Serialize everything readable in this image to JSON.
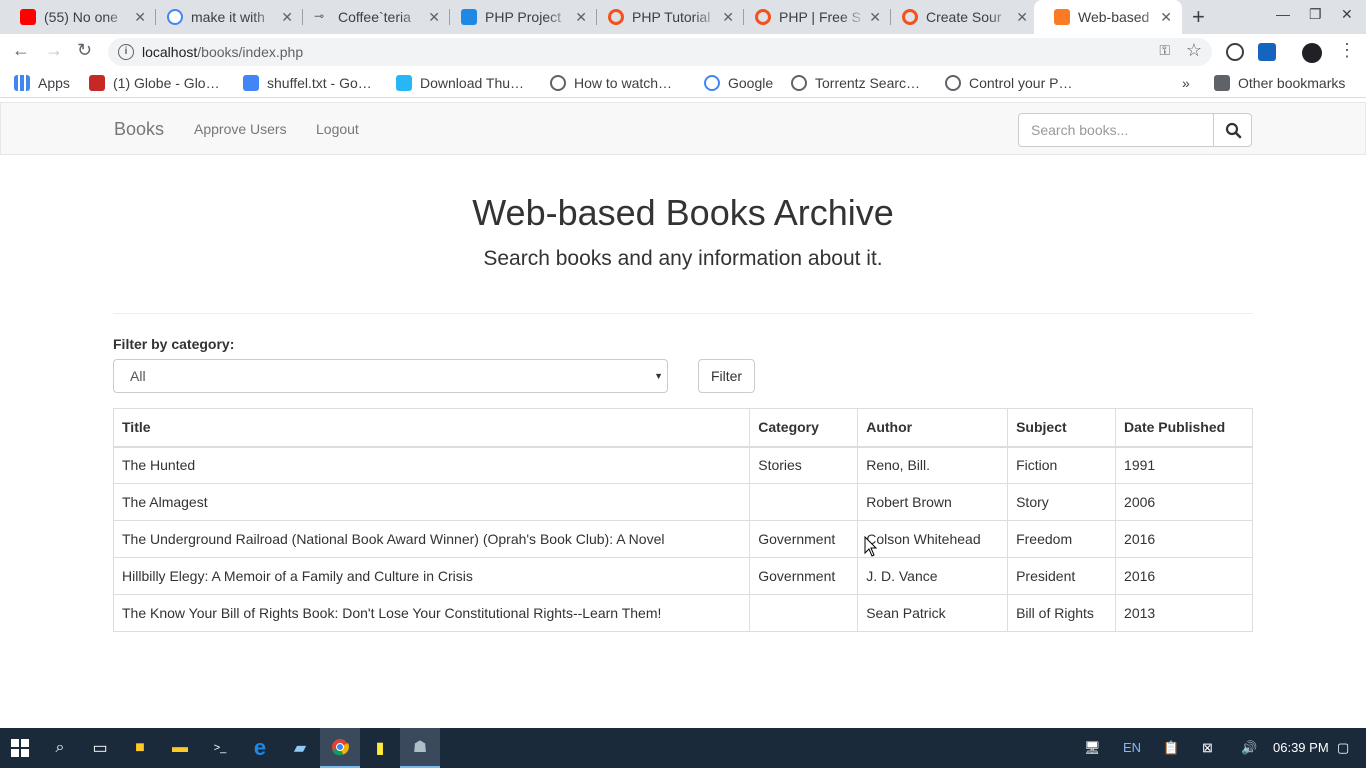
{
  "browser": {
    "tabs": [
      {
        "title": "(55) No one",
        "icon": "youtube-icon",
        "color": "#ff0000"
      },
      {
        "title": "make it with",
        "icon": "google-icon",
        "color": "#4285f4"
      },
      {
        "title": "Coffee`teria",
        "icon": "key-icon",
        "color": "#5f6368"
      },
      {
        "title": "PHP Project",
        "icon": "code-icon",
        "color": "#1e88e5"
      },
      {
        "title": "PHP Tutorial",
        "icon": "site-icon",
        "color": "#f4511e"
      },
      {
        "title": "PHP | Free S",
        "icon": "site-icon",
        "color": "#f4511e"
      },
      {
        "title": "Create Sour",
        "icon": "site-icon",
        "color": "#f4511e"
      },
      {
        "title": "Web-based",
        "icon": "xampp-icon",
        "color": "#fb7a24"
      }
    ],
    "url_host": "localhost",
    "url_path": "/books/index.php",
    "bookmarks": [
      {
        "label": "Apps",
        "color": "#4285f4"
      },
      {
        "label": "(1) Globe - Glo…",
        "color": "#c62828"
      },
      {
        "label": "shuffel.txt - Go…",
        "color": "#4285f4"
      },
      {
        "label": "Download Thu…",
        "color": "#29b6f6"
      },
      {
        "label": "How to watch…",
        "color": "#5f6368"
      },
      {
        "label": "Google",
        "color": "#4285f4"
      },
      {
        "label": "Torrentz Searc…",
        "color": "#5f6368"
      },
      {
        "label": "Control your P…",
        "color": "#5f6368"
      }
    ],
    "more_bookmarks": "»",
    "other_bookmarks": "Other bookmarks"
  },
  "navbar": {
    "brand": "Books",
    "links": [
      "Approve Users",
      "Logout"
    ],
    "search_placeholder": "Search books..."
  },
  "header": {
    "title": "Web-based Books Archive",
    "subtitle": "Search books and any information about it."
  },
  "filter": {
    "label": "Filter by category:",
    "selected": "All",
    "button": "Filter"
  },
  "table": {
    "headers": [
      "Title",
      "Category",
      "Author",
      "Subject",
      "Date Published"
    ],
    "rows": [
      [
        "The Hunted",
        "Stories",
        "Reno, Bill.",
        "Fiction",
        "1991"
      ],
      [
        "The Almagest",
        "",
        "Robert Brown",
        "Story",
        "2006"
      ],
      [
        "The Underground Railroad (National Book Award Winner) (Oprah's Book Club): A Novel",
        "Government",
        "Colson Whitehead",
        "Freedom",
        "2016"
      ],
      [
        "Hillbilly Elegy: A Memoir of a Family and Culture in Crisis",
        "Government",
        "J. D. Vance",
        "President",
        "2016"
      ],
      [
        "The Know Your Bill of Rights Book: Don't Lose Your Constitutional Rights--Learn Them!",
        "",
        "Sean Patrick",
        "Bill of Rights",
        "2013"
      ]
    ]
  },
  "taskbar": {
    "language": "EN",
    "time": "06:39 PM"
  }
}
